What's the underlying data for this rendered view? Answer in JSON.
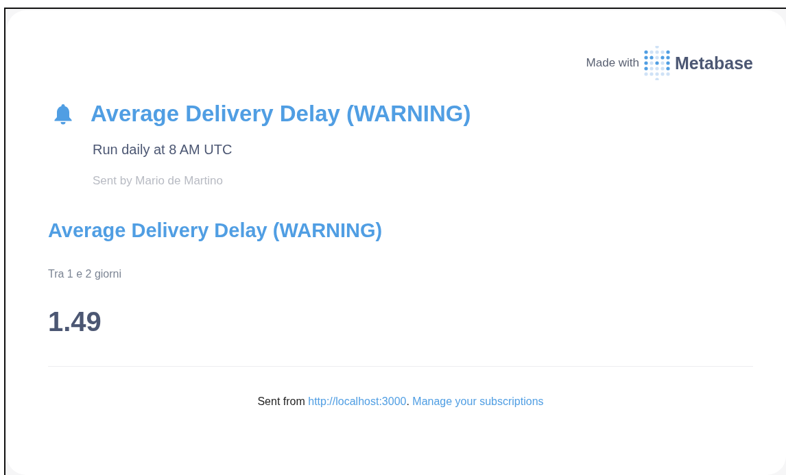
{
  "branding": {
    "made_with": "Made with",
    "brand": "Metabase"
  },
  "alert": {
    "title": "Average Delivery Delay (WARNING)",
    "schedule": "Run daily at 8 AM UTC",
    "sent_by": "Sent by Mario de Martino"
  },
  "card": {
    "title": "Average Delivery Delay (WARNING)",
    "description": "Tra 1 e 2 giorni",
    "value": "1.49"
  },
  "footer": {
    "prefix": "Sent from",
    "url_link": "http://localhost:3000",
    "separator": ".",
    "manage_link": "Manage your subscriptions"
  }
}
